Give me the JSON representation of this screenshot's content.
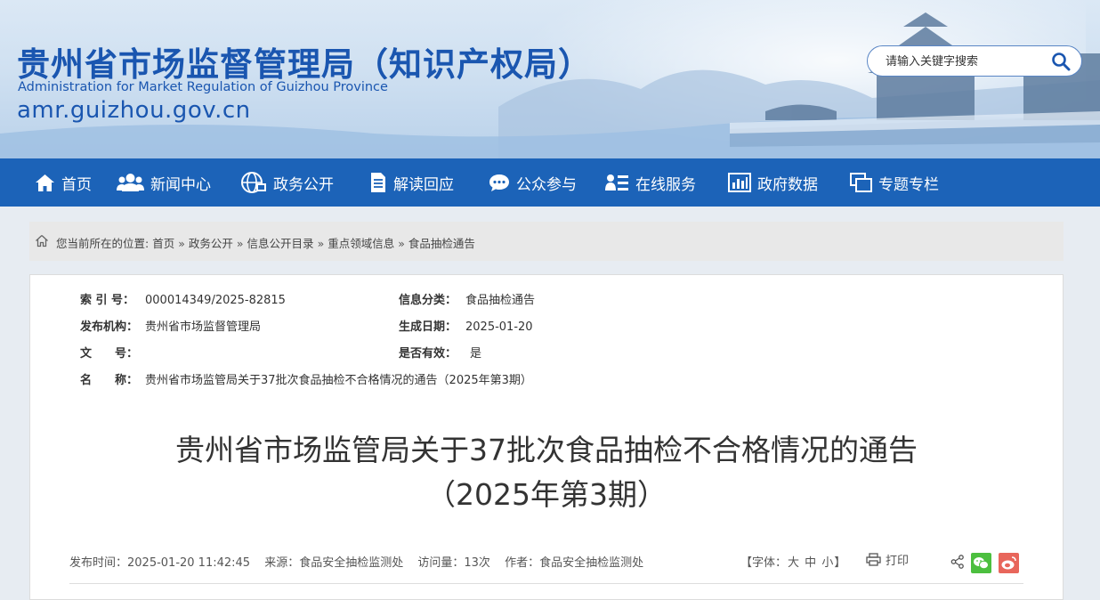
{
  "header": {
    "title": "贵州省市场监督管理局（知识产权局）",
    "subtitle_en": "Administration for Market Regulation of Guizhou Province",
    "url": "amr.guizhou.gov.cn",
    "search_placeholder": "请输入关键字搜索"
  },
  "nav": {
    "items": [
      {
        "label": "首页",
        "icon": "home-icon"
      },
      {
        "label": "新闻中心",
        "icon": "people-icon"
      },
      {
        "label": "政务公开",
        "icon": "globe-icon"
      },
      {
        "label": "解读回应",
        "icon": "document-icon"
      },
      {
        "label": "公众参与",
        "icon": "chat-icon"
      },
      {
        "label": "在线服务",
        "icon": "user-list-icon"
      },
      {
        "label": "政府数据",
        "icon": "bar-chart-icon"
      },
      {
        "label": "专题专栏",
        "icon": "window-icon"
      }
    ]
  },
  "breadcrumb": {
    "prefix": "您当前所在的位置:",
    "items": [
      "首页",
      "政务公开",
      "信息公开目录",
      "重点领域信息",
      "食品抽检通告"
    ],
    "separator": "»"
  },
  "meta": {
    "index_label": "索 引 号：",
    "index_value": "000014349/2025-82815",
    "category_label": "信息分类：",
    "category_value": "食品抽检通告",
    "publisher_label": "发布机构：",
    "publisher_value": "贵州省市场监督管理局",
    "date_label": "生成日期：",
    "date_value": "2025-01-20",
    "doc_no_label": "文　　号：",
    "doc_no_value": "",
    "valid_label": "是否有效：",
    "valid_value": "是",
    "name_label": "名　　称：",
    "name_value": "贵州省市场监管局关于37批次食品抽检不合格情况的通告（2025年第3期）"
  },
  "article": {
    "title_line1": "贵州省市场监管局关于37批次食品抽检不合格情况的通告",
    "title_line2": "（2025年第3期）",
    "publish_time": "发布时间：2025-01-20 11:42:45",
    "source": "来源：食品安全抽检监测处",
    "views": "访问量：13次",
    "author": "作者：食品安全抽检监测处",
    "font_prefix": "【字体：",
    "font_large": "大",
    "font_medium": "中",
    "font_small": "小",
    "font_suffix": "】",
    "print_label": "打印"
  },
  "colors": {
    "brand_blue": "#1a56b0",
    "nav_blue": "#1c63b8",
    "wechat_green": "#4cbf3f",
    "weibo_red": "#e8665b"
  }
}
